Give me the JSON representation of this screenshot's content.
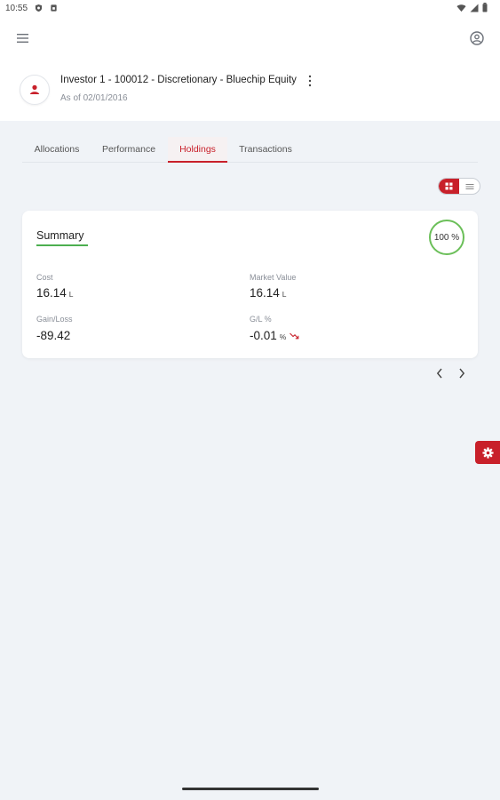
{
  "status_bar": {
    "time": "10:55"
  },
  "header": {
    "account_title": "Investor 1 - 100012 - Discretionary - Bluechip Equity",
    "as_of": "As of 02/01/2016"
  },
  "tabs": [
    {
      "label": "Allocations",
      "active": false
    },
    {
      "label": "Performance",
      "active": false
    },
    {
      "label": "Holdings",
      "active": true
    },
    {
      "label": "Transactions",
      "active": false
    }
  ],
  "summary": {
    "title": "Summary",
    "percent": "100 %",
    "cost": {
      "label": "Cost",
      "value": "16.14",
      "unit": "L"
    },
    "market_value": {
      "label": "Market Value",
      "value": "16.14",
      "unit": "L"
    },
    "gain_loss": {
      "label": "Gain/Loss",
      "value": "-89.42"
    },
    "gl_percent": {
      "label": "G/L %",
      "value": "-0.01",
      "unit": "%"
    }
  },
  "colors": {
    "accent_red": "#c8202a",
    "summary_green": "#4caf50",
    "background": "#f0f3f7"
  },
  "icons": [
    "menu-icon",
    "profile-icon",
    "avatar-icon",
    "kebab-icon",
    "grid-view-icon",
    "list-view-icon",
    "trend-down-icon",
    "chevron-left-icon",
    "chevron-right-icon",
    "gear-icon"
  ]
}
